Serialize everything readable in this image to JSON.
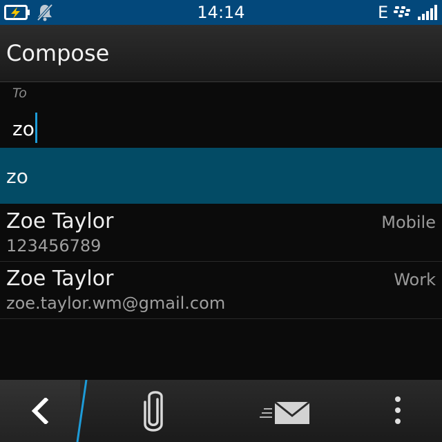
{
  "status_bar": {
    "time": "14:14",
    "network": "E",
    "icons": [
      "battery-charging-icon",
      "notifications-silent-icon",
      "blackberry-logo-icon",
      "signal-strength-icon"
    ],
    "background": "#03487b"
  },
  "header": {
    "title": "Compose"
  },
  "recipient": {
    "label": "To",
    "value": "zo"
  },
  "suggestions": {
    "highlighted": "zo",
    "highlight_color": "#034b65",
    "contacts": [
      {
        "name": "Zoe Taylor",
        "type": "Mobile",
        "detail": "123456789"
      },
      {
        "name": "Zoe Taylor",
        "type": "Work",
        "detail": "zoe.taylor.wm@gmail.com"
      }
    ]
  },
  "action_bar": {
    "icons": [
      "back-icon",
      "attach-icon",
      "send-icon",
      "overflow-menu-icon"
    ],
    "accent_color": "#1d9bd8"
  }
}
